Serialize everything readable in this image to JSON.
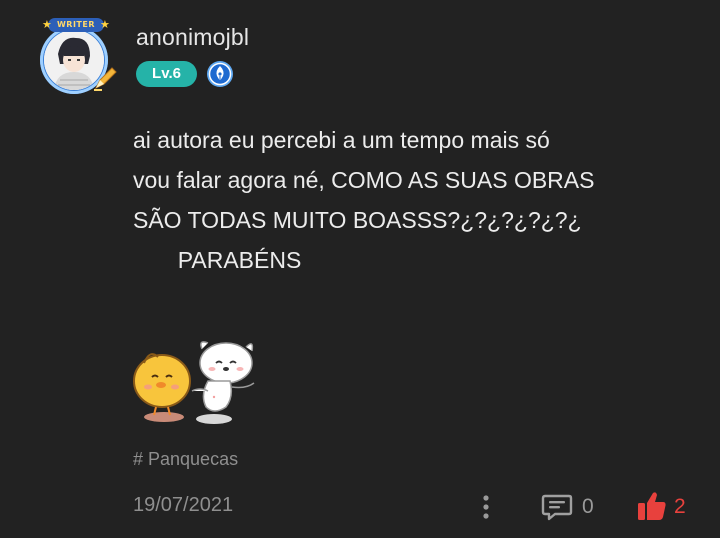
{
  "author": {
    "username": "anonimojbl",
    "level_label": "Lv.6",
    "avatar_frame_label": "WRITER",
    "level_color": "#25b3a8",
    "role_badge_icon": "quill-pen-icon",
    "role_badge_color": "#3b7fd6"
  },
  "post": {
    "body": "ai autora eu percebi a um tempo mais só\nvou falar agora né, COMO AS SUAS OBRAS\nSÃO TODAS MUITO BOASSS?¿?¿?¿?¿?¿\n       PARABÉNS",
    "sticker": "chick-and-puppy-sticker",
    "tag": "# Panquecas"
  },
  "footer": {
    "date": "19/07/2021",
    "more_icon": "more-vertical-icon",
    "comment_icon": "comment-icon",
    "comment_count": "0",
    "like_icon": "thumbs-up-icon",
    "like_count": "2",
    "like_color": "#e8413d"
  }
}
